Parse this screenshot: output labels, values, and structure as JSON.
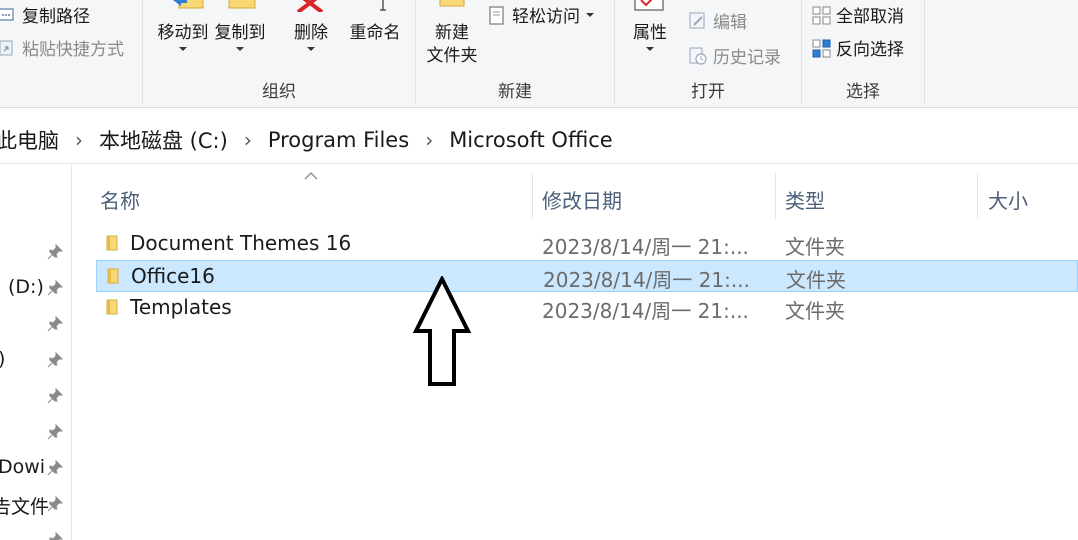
{
  "ribbon": {
    "clipboard": {
      "copy_path": "复制路径",
      "paste_shortcut": "粘贴快捷方式"
    },
    "organize": {
      "move_to": "移动到",
      "copy_to": "复制到",
      "delete": "删除",
      "rename": "重命名",
      "label": "组织"
    },
    "new": {
      "new_folder_line1": "新建",
      "new_folder_line2": "文件夹",
      "easy_access": "轻松访问",
      "label": "新建"
    },
    "open": {
      "properties": "属性",
      "edit": "编辑",
      "history": "历史记录",
      "label": "打开"
    },
    "select": {
      "select_none": "全部取消",
      "invert_selection": "反向选择",
      "label": "选择"
    }
  },
  "address": {
    "crumbs": [
      "此电脑",
      "本地磁盘 (C:)",
      "Program Files",
      "Microsoft Office"
    ],
    "separator": "›"
  },
  "nav": {
    "items": [
      {
        "label": ""
      },
      {
        "label": "(D:)"
      },
      {
        "label": ""
      },
      {
        "label": ")"
      },
      {
        "label": ""
      },
      {
        "label": ""
      },
      {
        "label": "Dowi"
      },
      {
        "label": "告文件"
      },
      {
        "label": ""
      }
    ]
  },
  "columns": {
    "name": "名称",
    "date": "修改日期",
    "type": "类型",
    "size": "大小"
  },
  "files": [
    {
      "name": "Document Themes 16",
      "date": "2023/8/14/周一 21:...",
      "type": "文件夹",
      "selected": false
    },
    {
      "name": "Office16",
      "date": "2023/8/14/周一 21:...",
      "type": "文件夹",
      "selected": true
    },
    {
      "name": "Templates",
      "date": "2023/8/14/周一 21:...",
      "type": "文件夹",
      "selected": false
    }
  ],
  "colors": {
    "selection_bg": "#cce8ff",
    "selection_border": "#99d1ff",
    "header_text": "#4c607a",
    "folder": "#f8d775"
  }
}
